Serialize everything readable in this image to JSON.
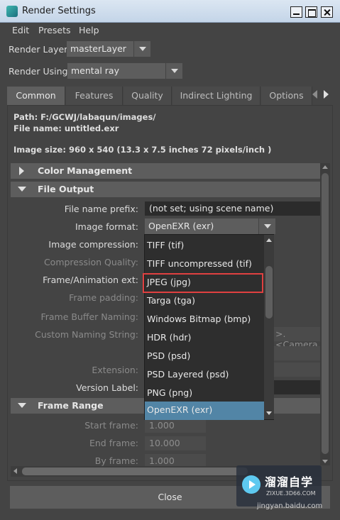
{
  "window": {
    "title": "Render Settings"
  },
  "menu": [
    "Edit",
    "Presets",
    "Help"
  ],
  "render_layer": {
    "label": "Render Layer",
    "value": "masterLayer"
  },
  "render_using": {
    "label": "Render Using",
    "value": "mental ray"
  },
  "tabs": [
    "Common",
    "Features",
    "Quality",
    "Indirect Lighting",
    "Options"
  ],
  "info": {
    "path": "Path: F:/GCWJ/labaqun/images/",
    "file_name": "File name:  untitled.exr",
    "image_size": "Image size: 960 x 540 (13.3 x 7.5 inches 72 pixels/inch )"
  },
  "sections": {
    "color_management": "Color Management",
    "file_output": "File Output",
    "frame_range": "Frame Range"
  },
  "file_output": {
    "prefix_label": "File name prefix:",
    "prefix_value": "(not set; using scene name)",
    "format_label": "Image format:",
    "format_value": "OpenEXR (exr)",
    "compression_label": "Image compression:",
    "comp_quality_label": "Compression Quality:",
    "frame_ext_label": "Frame/Animation ext:",
    "frame_padding_label": "Frame padding:",
    "fb_naming_label": "Frame Buffer Naming:",
    "custom_naming_label": "Custom Naming String:",
    "custom_naming_value": ">.<Camera",
    "extension_label": "Extension:",
    "version_label": "Version Label:"
  },
  "format_options": [
    "TIFF (tif)",
    "TIFF uncompressed (tif)",
    "JPEG (jpg)",
    "Targa (tga)",
    "Windows Bitmap (bmp)",
    "HDR (hdr)",
    "PSD (psd)",
    "PSD Layered (psd)",
    "PNG (png)",
    "OpenEXR (exr)"
  ],
  "frame_range": {
    "start_label": "Start frame:",
    "start_value": "1.000",
    "end_label": "End frame:",
    "end_value": "10.000",
    "by_label": "By frame:",
    "by_value": "1.000"
  },
  "close_label": "Close",
  "watermark": {
    "title": "溜溜自学",
    "sub": "ZIXUE.3D66.COM",
    "url": "jingyan.baidu.com"
  }
}
